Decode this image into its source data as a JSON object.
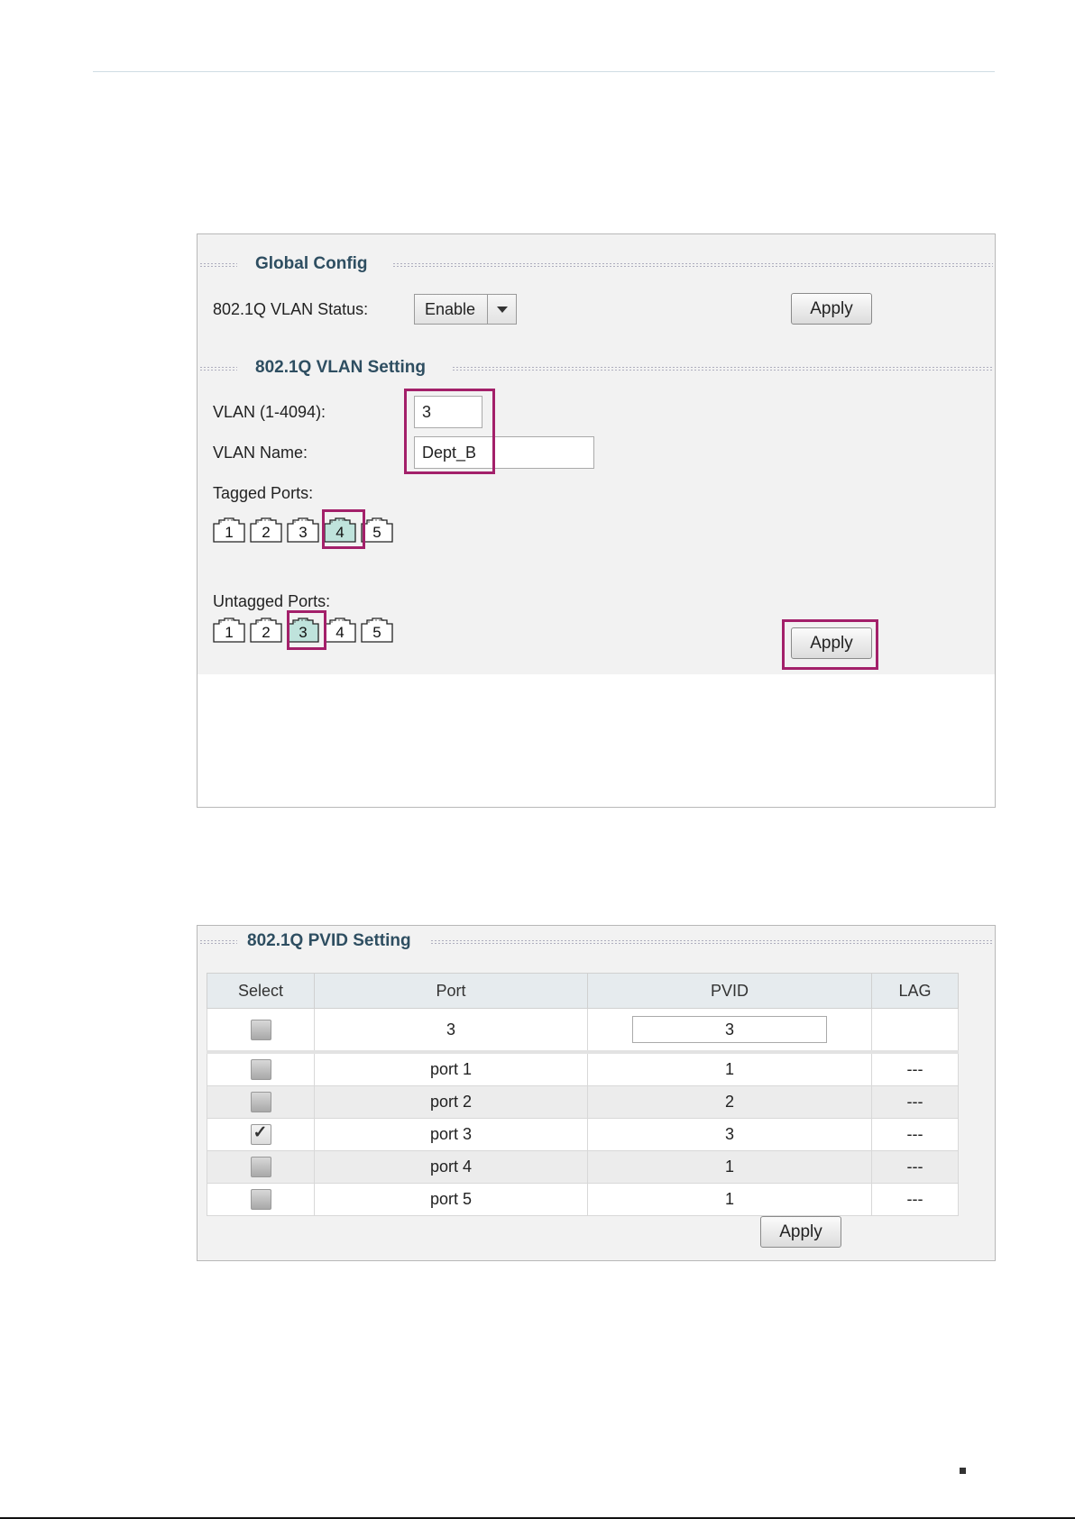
{
  "global_config": {
    "title": "Global Config",
    "status_label": "802.1Q VLAN Status:",
    "status_value": "Enable",
    "apply_label": "Apply"
  },
  "vlan_setting": {
    "title": "802.1Q VLAN Setting",
    "vlan_id_label": "VLAN (1-4094):",
    "vlan_id_value": "3",
    "vlan_name_label": "VLAN Name:",
    "vlan_name_value": "Dept_B",
    "tagged_label": "Tagged Ports:",
    "untagged_label": "Untagged Ports:",
    "ports": [
      "1",
      "2",
      "3",
      "4",
      "5"
    ],
    "tagged_selected": "4",
    "untagged_selected": "3",
    "apply_label": "Apply"
  },
  "pvid_setting": {
    "title": "802.1Q PVID Setting",
    "headers": [
      "Select",
      "Port",
      "PVID",
      "LAG"
    ],
    "edit_row": {
      "port": "3",
      "pvid": "3",
      "lag": ""
    },
    "rows": [
      {
        "port": "port 1",
        "pvid": "1",
        "lag": "---",
        "checked": false
      },
      {
        "port": "port 2",
        "pvid": "2",
        "lag": "---",
        "checked": false
      },
      {
        "port": "port 3",
        "pvid": "3",
        "lag": "---",
        "checked": true
      },
      {
        "port": "port 4",
        "pvid": "1",
        "lag": "---",
        "checked": false
      },
      {
        "port": "port 5",
        "pvid": "1",
        "lag": "---",
        "checked": false
      }
    ],
    "apply_label": "Apply"
  },
  "colors": {
    "highlight": "#a3206a",
    "selected_port": "#bfe3dc",
    "section_title": "#2e4e61"
  }
}
